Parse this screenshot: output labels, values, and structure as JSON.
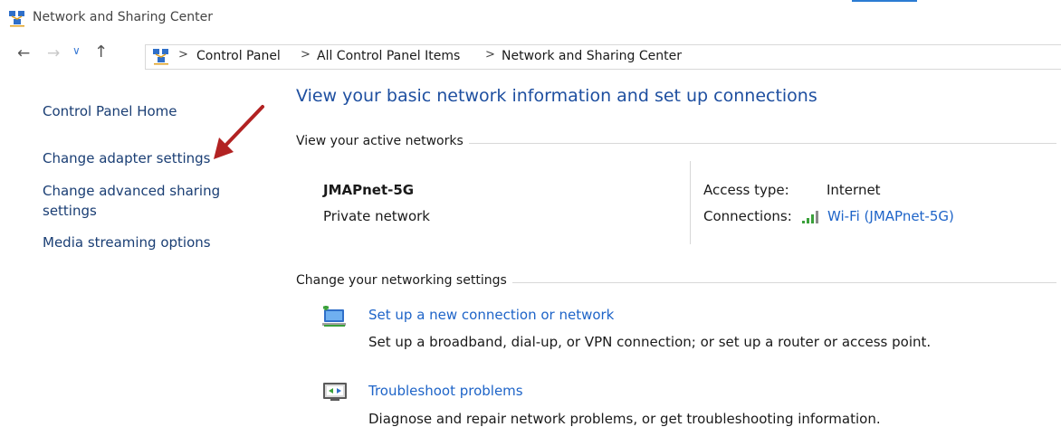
{
  "window": {
    "title": "Network and Sharing Center"
  },
  "address_bar": {
    "crumbs": [
      "Control Panel",
      "All Control Panel Items",
      "Network and Sharing Center"
    ],
    "separator": ">"
  },
  "sidebar": {
    "items": [
      {
        "label": "Control Panel Home"
      },
      {
        "label": "Change adapter settings"
      },
      {
        "label": "Change advanced sharing settings"
      },
      {
        "label": "Media streaming options"
      }
    ]
  },
  "main": {
    "heading": "View your basic network information and set up connections",
    "active_networks": {
      "section_title": "View your active networks",
      "network_name": "JMAPnet-5G",
      "network_type": "Private network",
      "access_type_label": "Access type:",
      "access_type_value": "Internet",
      "connections_label": "Connections:",
      "connection_link": "Wi-Fi (JMAPnet-5G)"
    },
    "networking_settings": {
      "section_title": "Change your networking settings",
      "tasks": [
        {
          "title": "Set up a new connection or network",
          "description": "Set up a broadband, dial-up, or VPN connection; or set up a router or access point."
        },
        {
          "title": "Troubleshoot problems",
          "description": "Diagnose and repair network problems, or get troubleshooting information."
        }
      ]
    }
  },
  "colors": {
    "link": "#1e64c8",
    "heading": "#1e4fa0",
    "annotation_arrow": "#b22222"
  }
}
